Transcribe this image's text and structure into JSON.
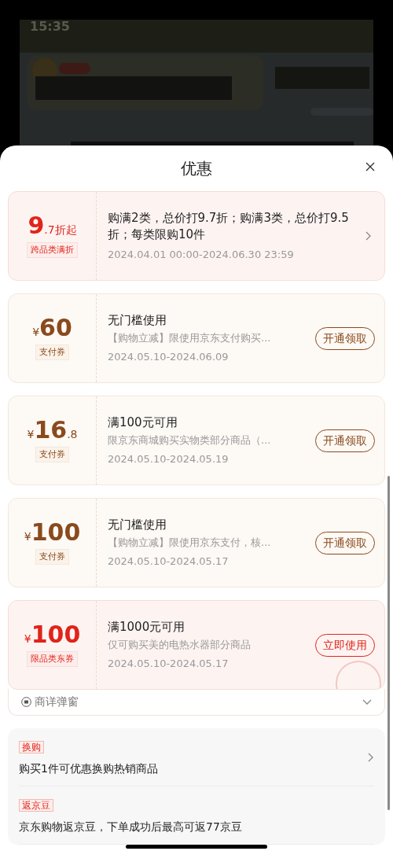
{
  "status_bar": {
    "time": "15:35"
  },
  "sheet": {
    "title": "优惠"
  },
  "coupons": [
    {
      "kind": "discount",
      "amount": "9",
      "decimal": ".7折起",
      "tag": "跨品类满折",
      "title": "购满2类，总价打9.7折；购满3类，总价打9.5折；每类限购10件",
      "date": "2024.04.01 00:00-2024.06.30 23:59"
    },
    {
      "kind": "payment",
      "currency": "¥",
      "amount": "60",
      "tag": "支付券",
      "title": "无门槛使用",
      "desc": "【购物立减】限使用京东支付购买...",
      "date": "2024.05.10-2024.06.09",
      "button": "开通领取"
    },
    {
      "kind": "payment",
      "currency": "¥",
      "amount": "16",
      "decimal": ".8",
      "tag": "支付券",
      "title": "满100元可用",
      "desc": "限京东商城购买实物类部分商品（...",
      "date": "2024.05.10-2024.05.19",
      "button": "开通领取"
    },
    {
      "kind": "payment",
      "currency": "¥",
      "amount": "100",
      "tag": "支付券",
      "title": "无门槛使用",
      "desc": "【购物立减】限使用京东支付，核...",
      "date": "2024.05.10-2024.05.17",
      "button": "开通领取"
    },
    {
      "kind": "category",
      "currency": "¥",
      "amount": "100",
      "tag": "限品类东券",
      "title": "满1000元可用",
      "desc": "仅可购买美的电热水器部分商品",
      "date": "2024.05.10-2024.05.17",
      "button": "立即使用",
      "claimed": true
    }
  ],
  "detail_toggle": {
    "label": "商详弹窗",
    "expanded": false
  },
  "promos": [
    {
      "tag": "换购",
      "text": "购买1件可优惠换购热销商品",
      "arrow": true
    },
    {
      "tag": "返京豆",
      "text": "京东购物返京豆，下单成功后最高可返77京豆",
      "arrow": false
    }
  ]
}
